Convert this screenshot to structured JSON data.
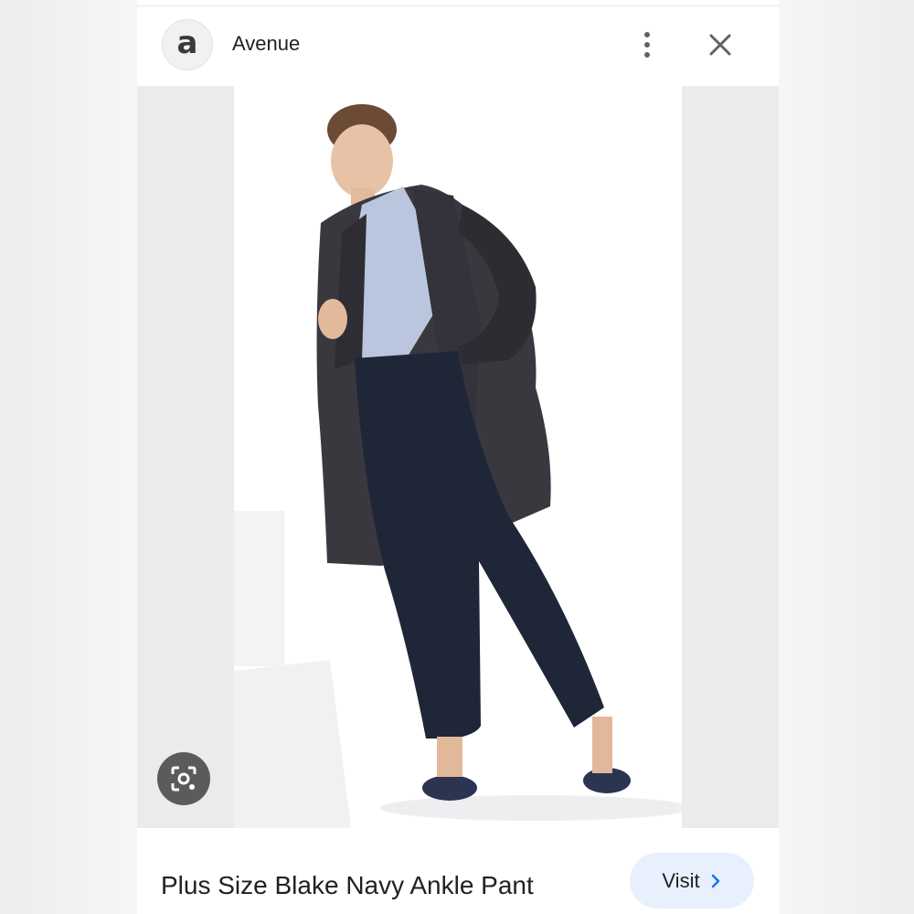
{
  "header": {
    "logo_letter": "a",
    "site_name": "Avenue",
    "menu_icon": "more-vert-icon",
    "close_icon": "close-icon"
  },
  "image": {
    "description_icon": "product-photo",
    "lens_icon": "lens-search-icon"
  },
  "product": {
    "title": "Plus Size Blake Navy Ankle Pant"
  },
  "actions": {
    "visit_label": "Visit",
    "visit_icon": "chevron-right-icon"
  },
  "colors": {
    "accent": "#1a73e8",
    "visit_bg": "#e8f0fe",
    "text": "#202124",
    "icon": "#5f6368"
  }
}
